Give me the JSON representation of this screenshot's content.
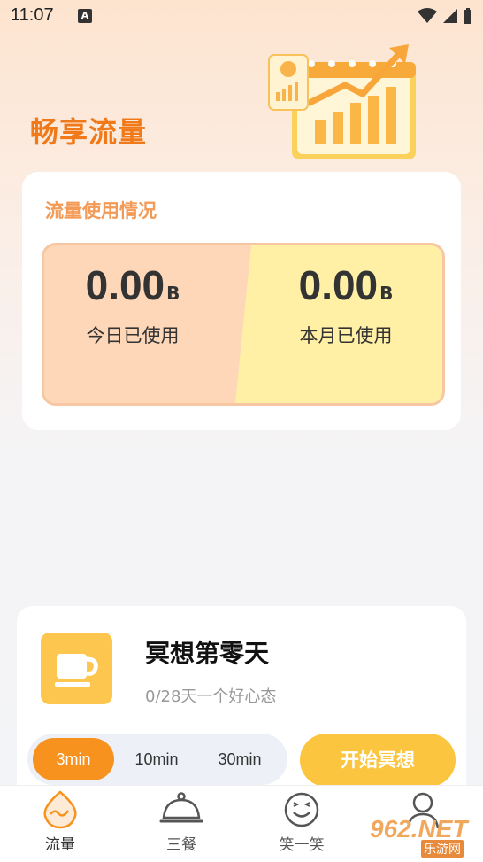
{
  "status_bar": {
    "time": "11:07",
    "notification_icon": "A"
  },
  "hero": {
    "title": "畅享流量"
  },
  "usage": {
    "title": "流量使用情况",
    "today": {
      "value": "0.00",
      "unit": "B",
      "label": "今日已使用"
    },
    "month": {
      "value": "0.00",
      "unit": "B",
      "label": "本月已使用"
    }
  },
  "meditation": {
    "title": "冥想第零天",
    "subtitle": "0/28天一个好心态",
    "durations": [
      "3min",
      "10min",
      "30min"
    ],
    "selected_duration": "3min",
    "start_label": "开始冥想"
  },
  "tabs": [
    {
      "label": "流量",
      "icon": "traffic-wave-icon",
      "active": true
    },
    {
      "label": "三餐",
      "icon": "dish-cover-icon",
      "active": false
    },
    {
      "label": "笑一笑",
      "icon": "smiley-icon",
      "active": false
    },
    {
      "label": "",
      "icon": "profile-icon",
      "active": false
    }
  ],
  "watermark": {
    "brand": "962",
    "suffix": ".NET",
    "sub": "乐游网"
  },
  "colors": {
    "accent": "#f8921f",
    "title_orange": "#f07a1a",
    "yellow": "#fcc540",
    "peach": "#fdd7b8"
  }
}
